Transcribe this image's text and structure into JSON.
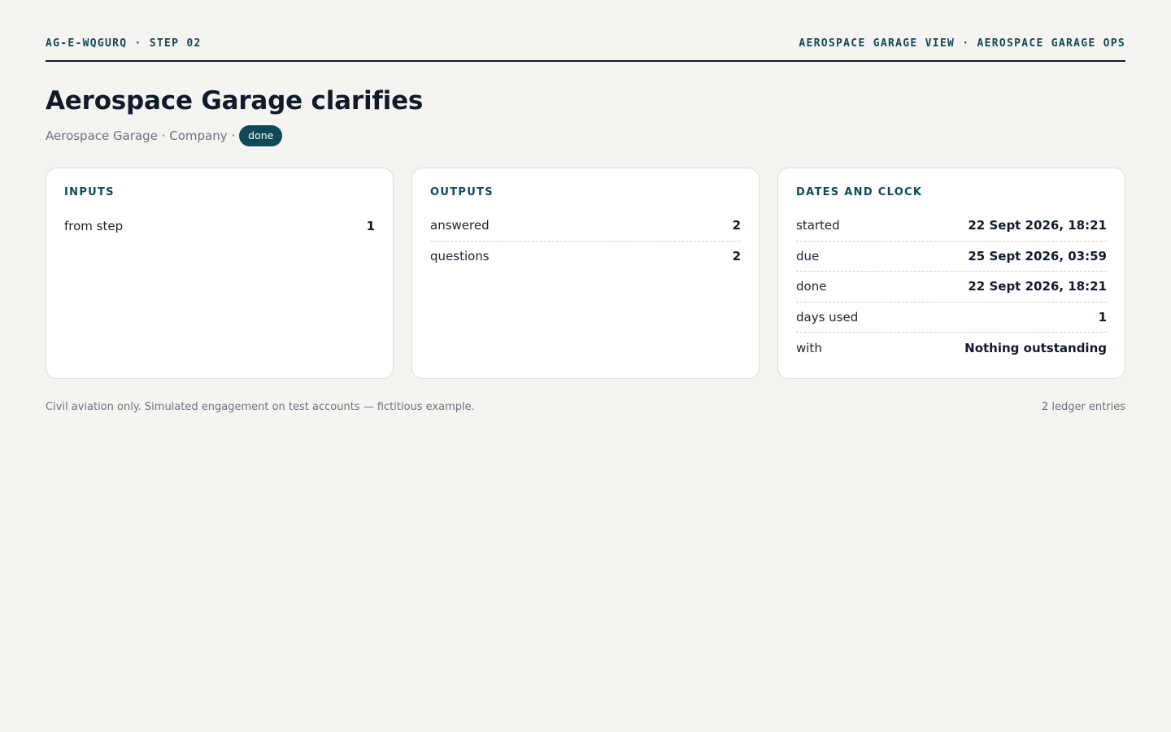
{
  "header": {
    "left": "AG-E-WQGURQ · STEP 02",
    "right": "AEROSPACE GARAGE VIEW · AEROSPACE GARAGE OPS"
  },
  "title": "Aerospace Garage clarifies",
  "subtitle": {
    "text": "Aerospace Garage · Company ·",
    "badge": "done"
  },
  "cards": [
    {
      "title": "INPUTS",
      "rows": [
        {
          "key": "from step",
          "value": "1"
        }
      ]
    },
    {
      "title": "OUTPUTS",
      "rows": [
        {
          "key": "answered",
          "value": "2"
        },
        {
          "key": "questions",
          "value": "2"
        }
      ]
    },
    {
      "title": "DATES AND CLOCK",
      "rows": [
        {
          "key": "started",
          "value": "22 Sept 2026, 18:21"
        },
        {
          "key": "due",
          "value": "25 Sept 2026, 03:59"
        },
        {
          "key": "done",
          "value": "22 Sept 2026, 18:21"
        },
        {
          "key": "days used",
          "value": "1"
        },
        {
          "key": "with",
          "value": "Nothing outstanding"
        }
      ]
    }
  ],
  "footer": {
    "note": "Civil aviation only. Simulated engagement on test accounts — fictitious example.",
    "entries": "2 ledger entries"
  },
  "colors": {
    "background": "#f5f4f0",
    "accent": "#0f4a58",
    "text": "#101a2b",
    "muted": "#6b7280"
  }
}
